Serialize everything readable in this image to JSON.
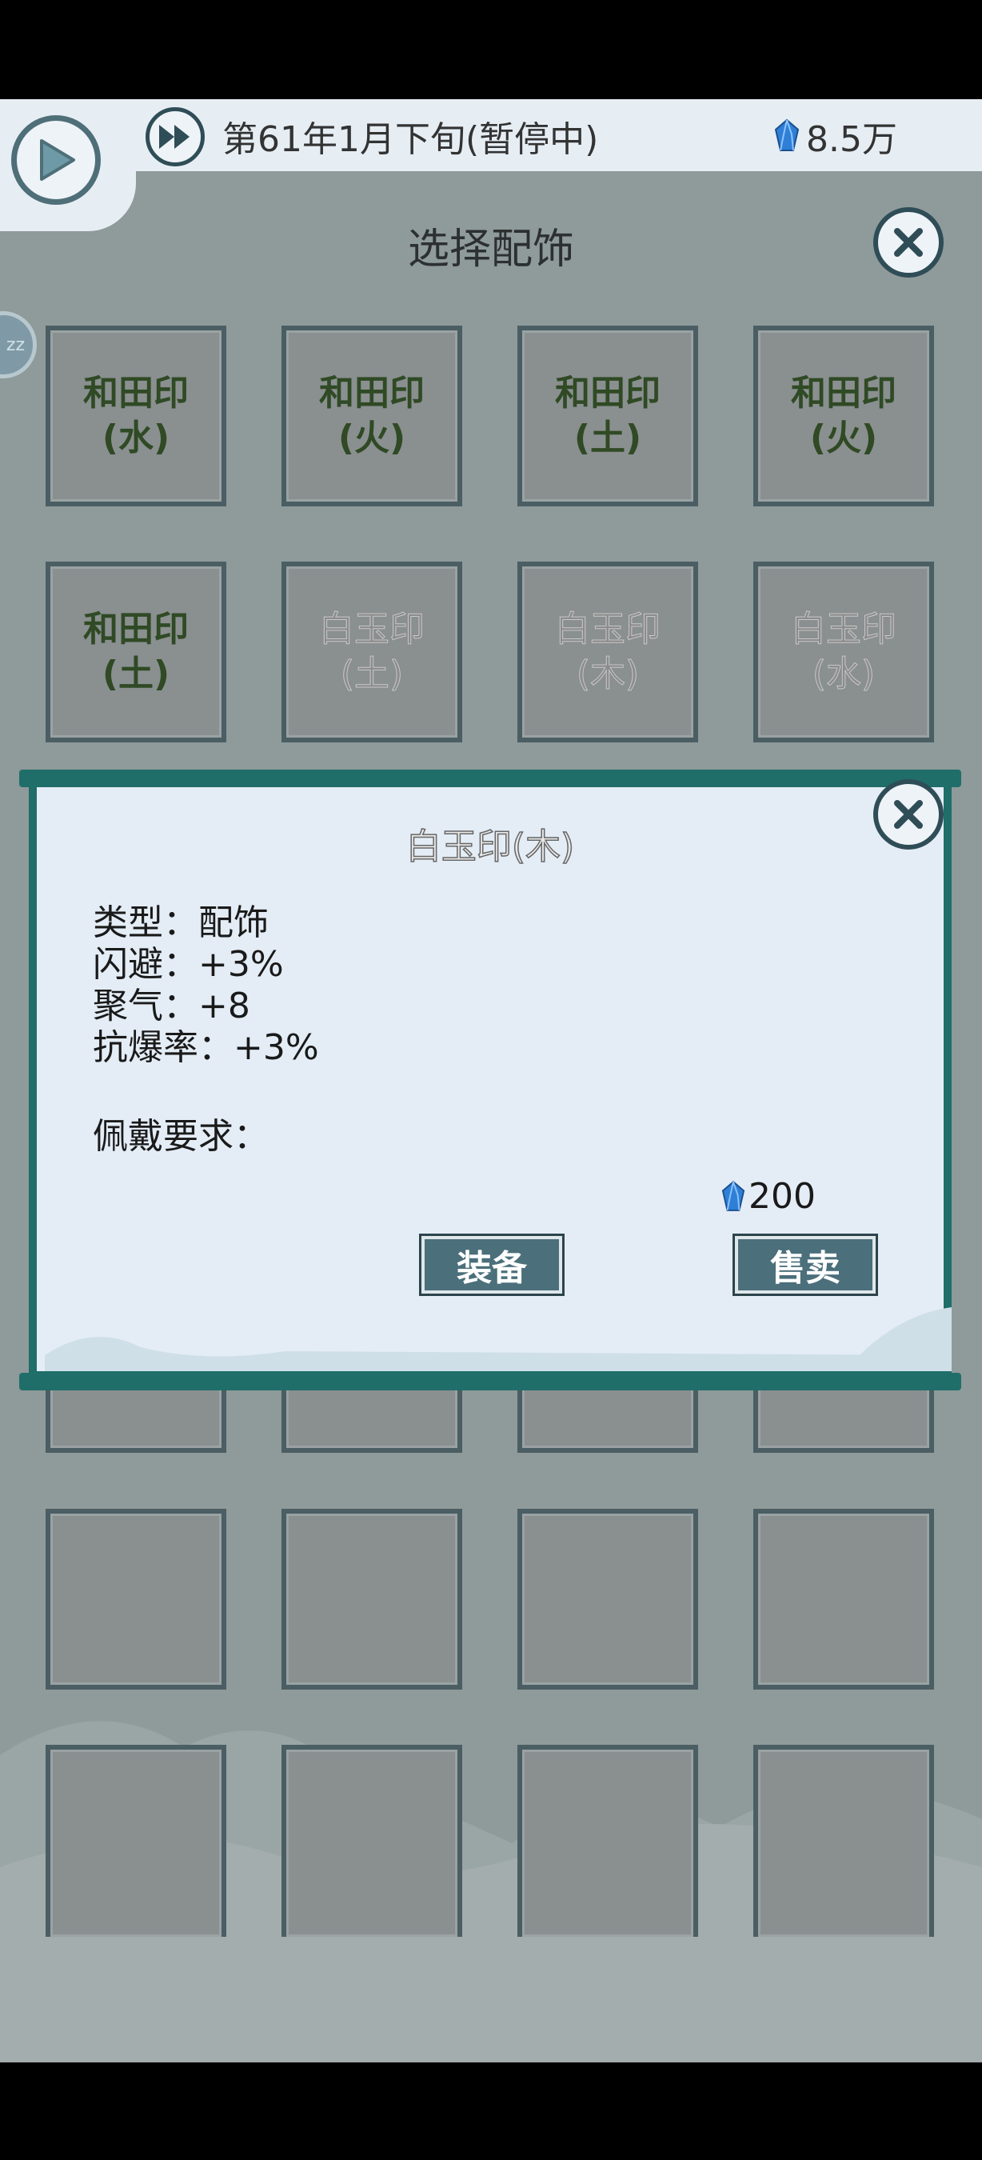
{
  "status": {
    "date_text": "第61年1月下旬(暂停中)",
    "gems": "8.5万"
  },
  "panel": {
    "title": "选择配饰"
  },
  "grid": {
    "slots": [
      {
        "label": "和田印(水)",
        "state": "owned"
      },
      {
        "label": "和田印(火)",
        "state": "owned"
      },
      {
        "label": "和田印(土)",
        "state": "owned"
      },
      {
        "label": "和田印(火)",
        "state": "owned"
      },
      {
        "label": "和田印(土)",
        "state": "owned"
      },
      {
        "label": "白玉印(土)",
        "state": "dim"
      },
      {
        "label": "白玉印(木)",
        "state": "dim"
      },
      {
        "label": "白玉印(水)",
        "state": "dim"
      }
    ]
  },
  "dialog": {
    "title": "白玉印(木)",
    "type_line": "类型：配饰",
    "dodge_line": "闪避：+3%",
    "qi_line": "聚气：+8",
    "crit_resist_line": "抗爆率：+3%",
    "requirement_label": "佩戴要求：",
    "price": "200",
    "equip_label": "装备",
    "sell_label": "售卖"
  },
  "colors": {
    "background": "#8f9a9a",
    "dialog_frame": "#1f6e69",
    "owned_text": "#2f4a24",
    "button": "#4b6f7b",
    "gem": "#2f7fd6"
  },
  "icons": [
    "play-icon",
    "fast-forward-icon",
    "gem-icon",
    "close-icon"
  ]
}
